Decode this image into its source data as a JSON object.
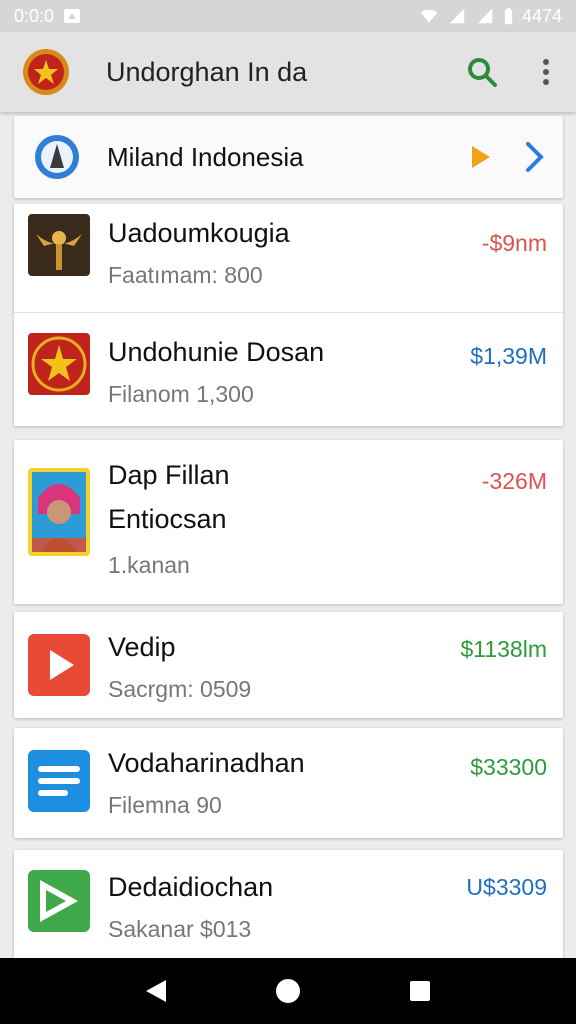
{
  "status_bar": {
    "left_text": "0:0:0",
    "time": "4474"
  },
  "app_bar": {
    "title": "Undorghan In da"
  },
  "banner": {
    "title": "Miland Indonesia"
  },
  "items": [
    {
      "title": "Uadoumkougia",
      "subtitle": "Faatımam: 800",
      "amount": "-$9nm",
      "amount_color": "#d9534f"
    },
    {
      "title": "Undohunie Dosan",
      "subtitle": "Filanom 1,300",
      "amount": "$1,39M",
      "amount_color": "#1f6fc4"
    },
    {
      "title": "Dap Fillan",
      "title2": "Entiocsan",
      "subtitle": "1.kanan",
      "amount": "-326M",
      "amount_color": "#d9534f"
    },
    {
      "title": "Vedip",
      "subtitle": "Sacrgm: 0509",
      "amount": "$1138lm",
      "amount_color": "#2e9b3a"
    },
    {
      "title": "Vodaharinadhan",
      "subtitle": "Filemna 90",
      "amount": "$33300",
      "amount_color": "#2e9b3a"
    },
    {
      "title": "Dedaidiochan",
      "subtitle": "Sakanar $013",
      "amount": "U$3309",
      "amount_color": "#1f6fc4"
    }
  ],
  "icons": {
    "logo": "emblem-icon",
    "search": "search-icon",
    "menu": "more-vert-icon",
    "banner_logo": "app-circle-icon",
    "play": "play-arrow-icon",
    "chevron": "chevron-right-icon",
    "back": "back-icon",
    "home": "home-icon",
    "recents": "recents-icon"
  }
}
